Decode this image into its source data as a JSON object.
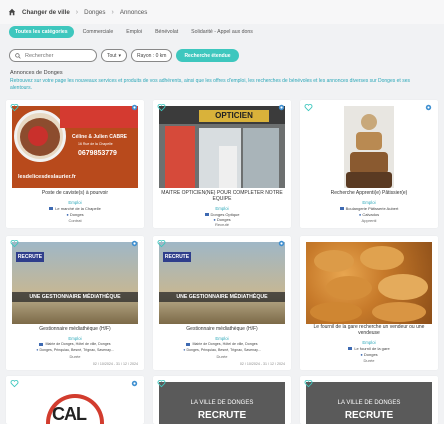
{
  "breadcrumb": {
    "items": [
      "Changer de ville",
      "Donges",
      "Annonces"
    ]
  },
  "tabs": [
    "Toutes les catégories",
    "Commerciale",
    "Emploi",
    "Bénévolat",
    "Solidarité - Appel aux dons"
  ],
  "search": {
    "placeholder": "Rechercher",
    "filter_label": "Tout",
    "radius_label": "Rayon : 0 km",
    "button_label": "Recherche étendue"
  },
  "section": {
    "title": "Annonces de Donges",
    "description": "Retrouvez sur votre page les nouveaux services et produits de vos adhérents, ainsi que les offres d'emploi, les recherches de bénévoles et les annonces diverses sur Donges et ses alentours."
  },
  "cards": [
    {
      "title": "Poste de caviste(s) à pourvoir",
      "category": "Emploi",
      "location": "Le marché de la Chapelle",
      "city": "Donges",
      "type": "Contrat",
      "img": {
        "name1": "Céline & Julien CABRE",
        "addr": "16 Rue de la Chapelle",
        "phone": "0679853779",
        "site": "lesdelicesdeslaurier.fr"
      }
    },
    {
      "title": "MAITRE OPTICIEN(NE) POUR COMPLETER NOTRE EQUIPE",
      "category": "Emploi",
      "location": "Donges Optique",
      "city": "Donges",
      "type": "Recruté",
      "img": {
        "sign": "OPTICIEN"
      }
    },
    {
      "title": "Recherche Apprenti(e) Pâtissier(e)",
      "category": "Emploi",
      "location": "Boulangerie Pâtisserie Aubert",
      "city": "Calvados",
      "type": "Apprenti"
    },
    {
      "title": "Gestionnaire médiathèque (H/F)",
      "category": "Emploi",
      "location": "Mairie de Donges, Hôtel de ville, Donges",
      "city": "Donges, Prinquiau, Besné, Trignac, Savenay...",
      "type": "Durée",
      "date": "02 / 10/2024 - 31 / 12 / 2024",
      "img": {
        "banner": "RECRUTE",
        "caption": "UNE GESTIONNAIRE MÉDIATHÈQUE"
      }
    },
    {
      "title": "Gestionnaire médiathèque (H/F)",
      "category": "Emploi",
      "location": "Mairie de Donges, Hôtel de ville, Donges",
      "city": "Donges, Prinquiau, Besné, Trignac, Savenay...",
      "type": "Durée",
      "date": "02 / 10/2024 - 31 / 12 / 2024",
      "img": {
        "banner": "RECRUTE",
        "caption": "UNE GESTIONNAIRE MÉDIATHÈQUE"
      }
    },
    {
      "title": "Le fournil de la gare recherche un vendeur ou une vendeuse",
      "category": "Emploi",
      "location": "Le fournil de la gare",
      "city": "Donges",
      "type": "Durée"
    },
    {
      "img": {
        "logo": "CAL"
      }
    },
    {
      "img": {
        "line": "LA VILLE DE DONGES",
        "banner": "RECRUTE"
      }
    },
    {
      "img": {
        "line": "LA VILLE DE DONGES",
        "banner": "RECRUTE"
      }
    }
  ],
  "colors": {
    "accent": "#3ec7be",
    "link": "#2aa7b8"
  }
}
